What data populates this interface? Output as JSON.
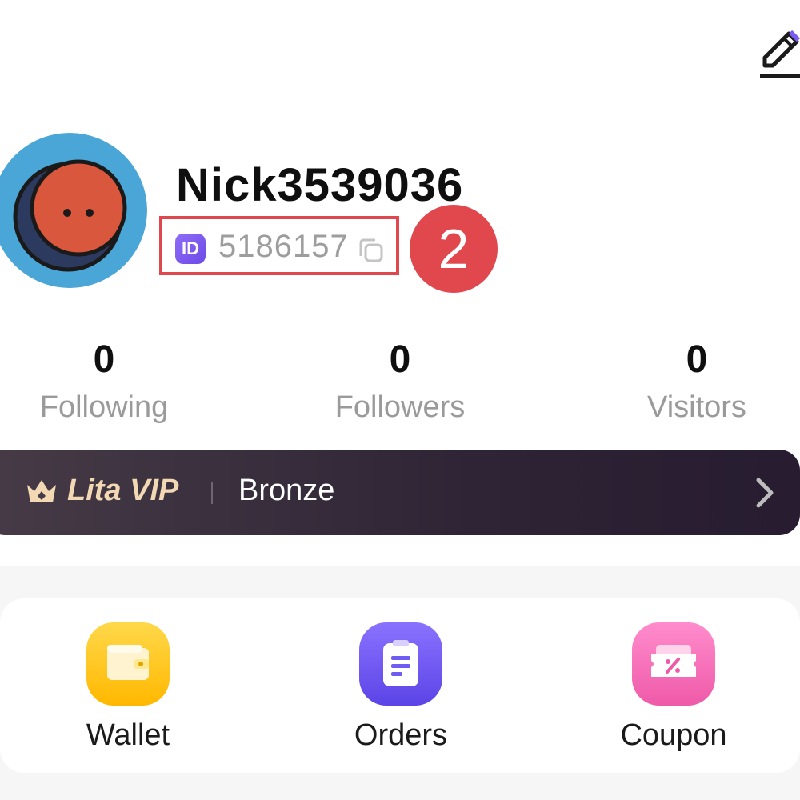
{
  "profile": {
    "username": "Nick3539036",
    "id_badge": "ID",
    "id_value": "5186157"
  },
  "annotation": {
    "step_number": "2"
  },
  "stats": [
    {
      "value": "0",
      "label": "Following"
    },
    {
      "value": "0",
      "label": "Followers"
    },
    {
      "value": "0",
      "label": "Visitors"
    }
  ],
  "vip": {
    "label": "Lita VIP",
    "tier": "Bronze"
  },
  "shortcuts": [
    {
      "label": "Wallet",
      "icon": "wallet-icon"
    },
    {
      "label": "Orders",
      "icon": "orders-icon"
    },
    {
      "label": "Coupon",
      "icon": "coupon-icon"
    }
  ],
  "colors": {
    "annotation_red": "#e0484e",
    "id_purple": "#7c5cf0",
    "vip_dark": "#2e2435",
    "vip_gold": "#f2d9b4",
    "wallet_yellow": "#ffc61a",
    "orders_purple": "#6f5cf2",
    "coupon_pink": "#f26bb8"
  }
}
